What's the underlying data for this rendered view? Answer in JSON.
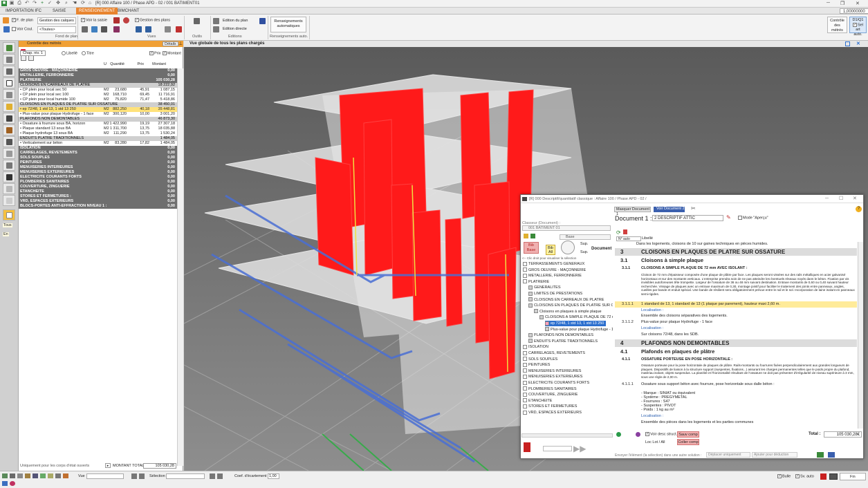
{
  "window": {
    "title": "[R] 000   Affaire 100 / Phase APD - 02 / 001 BATIMENT01"
  },
  "ribbon": {
    "tabs": [
      "IMPORTATION IFC",
      "SAISIE",
      "RENSEIGNEMENT",
      "BIMCHANT"
    ],
    "active_tab": "RENSEIGNEMENT",
    "zoom": "1,00000000",
    "f_de_plan": "F. de plan",
    "gestion_calques": "Gestion des calques",
    "voir_saisie": "Voir la saisie",
    "voir_coul": "Voir Coul.",
    "toutes": "<Toutes>",
    "gestion_plans": "Gestion des plans",
    "edition_plan": "Edition du plan",
    "edition_directe": "Edition directe",
    "renseignements_auto": "Renseignements automatiques",
    "groups": [
      "Fond de plan",
      "Vues",
      "Outils",
      "Editions",
      "Renseignements auto."
    ],
    "controle": "Contrôle des métrés",
    "d1q1": "D1/Q1",
    "sel_art_auto": "Sel art auto."
  },
  "left_panel": {
    "title": "Contrôle des métrés",
    "details": "Détails",
    "chap_level": "Chap. niv. 1",
    "libelle": "Libellé",
    "titre": "Titre",
    "prix": "Prix",
    "montant": "Montant",
    "col_headers": {
      "u": "U",
      "quantite": "Quantité",
      "prix": "Prix",
      "montant": "Montant"
    },
    "rows": [
      {
        "type": "hd",
        "label": "GROS OEUVRE - MAÇONNERIE",
        "m": "0,00"
      },
      {
        "type": "hd",
        "label": "METALLERIE, FERRONNERIE",
        "m": "0,00"
      },
      {
        "type": "hd",
        "label": "PLATRERIE",
        "m": "105 030,28"
      },
      {
        "type": "sub",
        "label": "CLOISONS EN CARREAUX DE PLATRE",
        "m": "18 222,92"
      },
      {
        "type": "it",
        "label": "• CP plein pour local sec 50",
        "u": "M2",
        "q": "23,680",
        "p": "45,91",
        "m": "1 087,15"
      },
      {
        "type": "it",
        "label": "• CP plein pour local sec 100",
        "u": "M2",
        "q": "168,710",
        "p": "69,45",
        "m": "11 716,91"
      },
      {
        "type": "it",
        "label": "• CP plein pour local humide 100",
        "u": "M2",
        "q": "75,820",
        "p": "71,47",
        "m": "5 418,86"
      },
      {
        "type": "sub",
        "label": "CLOISONS EN PLAQUES DE PLATRE SUR OSSATURE",
        "m": "38 450,01"
      },
      {
        "type": "sel",
        "label": "• ep 72/48, 1 std 13, 1 std 13 250",
        "u": "M2",
        "q": "882,250",
        "p": "40,18",
        "m": "35 448,81"
      },
      {
        "type": "it",
        "label": "• Plus-value pour plaque Hydrofuge - 1 face",
        "u": "M2",
        "q": "300,120",
        "p": "10,00",
        "m": "3 001,20"
      },
      {
        "type": "sub",
        "label": "PLAFONDS NON DEMONTABLES",
        "m": "46 873,30"
      },
      {
        "type": "it",
        "label": "• Ossature à fourrure sous BA, horizon",
        "u": "M2",
        "q": "1 422,990",
        "p": "19,19",
        "m": "27 307,18"
      },
      {
        "type": "it",
        "label": "• Plaque standard 13 sous BA",
        "u": "M2",
        "q": "1 311,700",
        "p": "13,75",
        "m": "18 035,88"
      },
      {
        "type": "it",
        "label": "• Plaque hydrofuge 13 sous BA",
        "u": "M2",
        "q": "111,290",
        "p": "13,75",
        "m": "1 530,24"
      },
      {
        "type": "sub",
        "label": "ENDUITS PLATRE TRADITIONNELS",
        "m": "1 484,05"
      },
      {
        "type": "it",
        "label": "• Verticalement sur béton",
        "u": "M2",
        "q": "83,280",
        "p": "17,82",
        "m": "1 484,05"
      },
      {
        "type": "hd",
        "label": "ISOLATION",
        "m": "0,00"
      },
      {
        "type": "hd",
        "label": "CARRELAGES, REVETEMENTS",
        "m": "0,00"
      },
      {
        "type": "hd",
        "label": "SOLS SOUPLES",
        "m": "0,00"
      },
      {
        "type": "hd",
        "label": "PEINTURES",
        "m": "0,00"
      },
      {
        "type": "hd",
        "label": "MENUISERIES INTERIEURES",
        "m": "0,00"
      },
      {
        "type": "hd",
        "label": "MENUISERIES EXTERIEURES",
        "m": "0,00"
      },
      {
        "type": "hd",
        "label": "ELECTRICITE COURANTS FORTS",
        "m": "0,00"
      },
      {
        "type": "hd",
        "label": "PLOMBERIES SANITAIRES",
        "m": "0,00"
      },
      {
        "type": "hd",
        "label": "COUVERTURE, ZINGUERIE",
        "m": "0,00"
      },
      {
        "type": "hd",
        "label": "ETANCHEITE",
        "m": "0,00"
      },
      {
        "type": "hd",
        "label": "STORES ET FERMETURES :",
        "m": "0,00"
      },
      {
        "type": "hd",
        "label": "VRD, ESPACES EXTERIEURS",
        "m": "0,00"
      },
      {
        "type": "hd",
        "label": "BLOCS-PORTES ANTI-EFFRACTION NIVEAU 1 :",
        "m": "0,00"
      }
    ],
    "footer_note": "Uniquement pour les corps d'état ouverts",
    "total_label": "MONTANT TOTAL",
    "total": "105 030,28"
  },
  "strip": {
    "tous": "Tous",
    "en": "En"
  },
  "viewport": {
    "title": "Vue globale de tous les plans chargés"
  },
  "dialog": {
    "title": "[R] 000 Descriptif/quantitatif classique : Affaire 100 / Phase APD - 02 /",
    "classeur_label": "Classeur (Document) :",
    "classeur": "001 BATIMENT 01",
    "base": "Base",
    "bib_base": "Bib Base",
    "bib_all": "Bib All",
    "sup": "Sup.",
    "document": "Document",
    "hint": "<-- Clic droit pour visualiser la sélection",
    "tree": [
      {
        "l": "TERRASSEMENTS GENERAUX",
        "d": 0
      },
      {
        "l": "GROS OEUVRE - MAÇONNERIE",
        "d": 0
      },
      {
        "l": "METALLERIE, FERRONNERIE",
        "d": 0
      },
      {
        "l": "PLATRERIE",
        "d": 0
      },
      {
        "l": "GENERALITES",
        "d": 1
      },
      {
        "l": "LIMITES DE PRESTATIONS",
        "d": 1
      },
      {
        "l": "CLOISONS EN CARREAUX DE PLATRE",
        "d": 1
      },
      {
        "l": "CLOISONS EN PLAQUES DE PLATRE SUR O",
        "d": 1
      },
      {
        "l": "Cloisons en plaques à simple plaque",
        "d": 2
      },
      {
        "l": "CLOISONS A SIMPLE PLAQUE DE 72 m",
        "d": 3
      },
      {
        "l": "ep 72/48, 1 std 13, 1 std 13 250",
        "d": 4,
        "sel": true
      },
      {
        "l": "Plus-value pour plaque Hydrofuge - 1 f",
        "d": 4
      },
      {
        "l": "PLAFONDS NON DEMONTABLES",
        "d": 1
      },
      {
        "l": "ENDUITS PLATRE TRADITIONNELS",
        "d": 1
      },
      {
        "l": "ISOLATION",
        "d": 0
      },
      {
        "l": "CARRELAGES, REVETEMENTS",
        "d": 0
      },
      {
        "l": "SOLS SOUPLES",
        "d": 0
      },
      {
        "l": "PEINTURES",
        "d": 0
      },
      {
        "l": "MENUISERIES INTERIEURES",
        "d": 0
      },
      {
        "l": "MENUISERIES EXTERIEURES",
        "d": 0
      },
      {
        "l": "ELECTRICITE COURANTS FORTS",
        "d": 0
      },
      {
        "l": "PLOMBERIES SANITAIRES",
        "d": 0
      },
      {
        "l": "COUVERTURE, ZINGUERIE",
        "d": 0
      },
      {
        "l": "ETANCHEITE",
        "d": 0
      },
      {
        "l": "STORES ET FERMETURES",
        "d": 0
      },
      {
        "l": "VRD, ESPACES EXTERIEURS",
        "d": 0
      }
    ],
    "tab1": "Masquer Document 1",
    "tab2": "Voir Document 2",
    "doc_label": "Document 1 :",
    "doc_value": "2  DESCRIPTIF ATTIC",
    "mode_apercu": "Mode \"Aperçu\"",
    "n_auto": "N° auto",
    "libelle_col": "Libellé",
    "doc": {
      "intro": "Dans les logements, cloisons de 10 sur gaines techniques en pièces humides.",
      "h3_num": "3",
      "h3": "CLOISONS EN PLAQUES DE PLATRE SUR OSSATURE",
      "h31_num": "3.1",
      "h31": "Cloisons à simple plaque",
      "h311_num": "3.1.1",
      "h311": "CLOISONS A SIMPLE PLAQUE DE 72 mm AVEC ISOLANT :",
      "p311": "Cloison de 72 mm d'épaisseur composée d'une plaque de plâtre par face. Les plaques seront vissées sur des rails métalliques en acier galvanisé horizontaux et sur des montants verticaux. L'entreprise prendra soin de ne pas atteindre les éventuels réseaux noyés dans le béton. Fixation par vis invisibles autoforeuses tête trompette. Largeur de l'ossature de 36 ou 48 mm suivant destination. Entraxe montants de 0,60 ou 0,40 suivant hauteur recherchée. Vissage de plaques avec un entraxe maximum de 0,30, montage jointif pour faciliter le traitement des joints entre panneaux, angles, cueilles par bande et enduit spécial. Une bande de résilient sera obligatoirement prévue entre le rail et le sol. Incorporation de laine isolant en panneaux semi-rigides.",
      "s3111_num": "3.1.1.1",
      "s3111": "1 standard de 13, 1 standard de 13 (1 plaque par parement), hauteur maxi 2,60 m.",
      "loc": "Localisation :",
      "loc1": "Ensemble des cloisons séparatives des logements.",
      "s3112_num": "3.1.1.2",
      "s3112": "Plus-value pour plaque Hydrofuge - 1 face",
      "loc2": "Sur cloisons 72/48, dans les SDB.",
      "h4_num": "4",
      "h4": "PLAFONDS NON DEMONTABLES",
      "h41_num": "4.1",
      "h41": "Plafonds en plaques de plâtre",
      "h411_num": "4.1.1",
      "h411": "OSSATURE PORTEUSE EN POSE HORIZONTALE :",
      "p411": "Ossature porteuse pour la pose horizontale de plaques de plâtre. Rails-montants ou fourrures fixées perpendiculairement aux grandes longueurs de plaques. Dispositifs de liaison à la structure support (suspentes, fixations...) assurant les charges permanentes telles que le poids propre du plafond, matériau isolant, objets suspendus. La planéité et l'horizontalité résultant de l'ossature ne doit pas présenter d'irrégularité de niveau supérieure à 3 mm, sous une règle de 2,00 m.",
      "s4111_num": "4.1.1.1",
      "s4111": "Ossature sous support béton avec fourrure, pose horizontale sous dalle béton :",
      "marque": "- Marque : SINIAT ou équivalent",
      "systeme": "- Système : PREGYMETAL",
      "fourrure": "- Fourrures : S47",
      "suspente": "- Suspentes : PIVOT",
      "poids": "- Poids : 1 kg au m²",
      "loc3": "Ensemble des pièces dans les logements et les parties communes"
    },
    "bottom": {
      "voir_desc": "Voir desc struct.",
      "sauv_comp": "Sauv comp",
      "coller_comp": "Coller comp",
      "loc_lot": "Loc Lot / All",
      "total_label": "Total :",
      "total": "105 030,28€",
      "envoyer": "Envoyer l'élément (la sélection) dans une autre solution :",
      "deplacer": "Déplacer uniquement",
      "ajouter": "Ajouter pour déduction"
    }
  },
  "statusbar": {
    "vue_label": "Vue",
    "selection_label": "Sélection",
    "coef": "Coef. d'écartement",
    "coef_value": "1,00",
    "bulle": "Bulle",
    "sv_auto": "Sv. auto",
    "fin": "Fin"
  },
  "colors": {
    "accent": "#e8842e",
    "wall_red": "#ff1a1a",
    "selection": "#ffe27a"
  }
}
